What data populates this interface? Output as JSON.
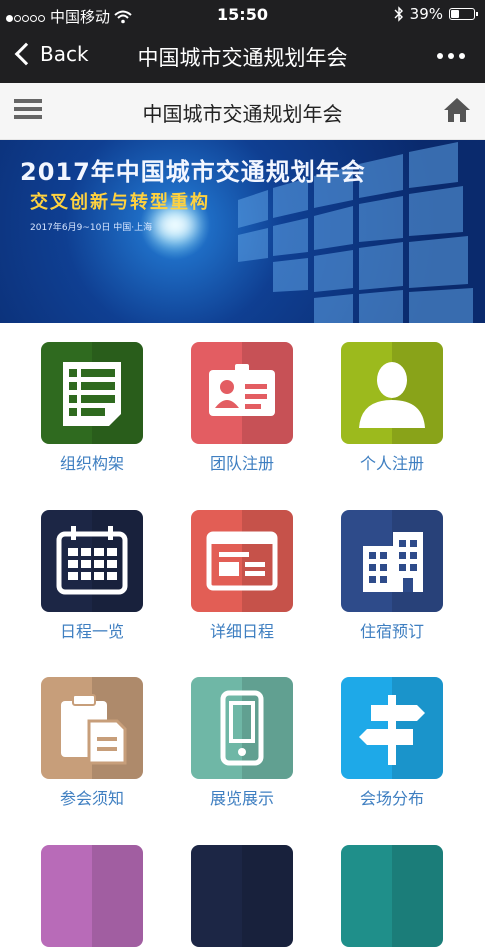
{
  "status_bar": {
    "carrier": "中国移动",
    "time": "15:50",
    "battery": "39%",
    "battery_level": 0.39
  },
  "nav": {
    "back_label": "Back",
    "title": "中国城市交通规划年会"
  },
  "page_header": {
    "title": "中国城市交通规划年会"
  },
  "banner": {
    "title": "2017年中国城市交通规划年会",
    "subtitle": "交叉创新与转型重构",
    "date_line": "2017年6月9~10日   中国·上海"
  },
  "grid": [
    {
      "label": "组织构架",
      "icon": "org-chart-icon",
      "color": "#2f6a1f"
    },
    {
      "label": "团队注册",
      "icon": "id-card-icon",
      "color": "#e35d62"
    },
    {
      "label": "个人注册",
      "icon": "user-icon",
      "color": "#9cba1d"
    },
    {
      "label": "日程一览",
      "icon": "calendar-icon",
      "color": "#1c2645"
    },
    {
      "label": "详细日程",
      "icon": "browser-window-icon",
      "color": "#e25e55"
    },
    {
      "label": "住宿预订",
      "icon": "building-icon",
      "color": "#2e4b8a"
    },
    {
      "label": "参会须知",
      "icon": "clipboard-icon",
      "color": "#c79e7a"
    },
    {
      "label": "展览展示",
      "icon": "mobile-device-icon",
      "color": "#6fb7a6"
    },
    {
      "label": "会场分布",
      "icon": "signpost-icon",
      "color": "#1ea9e8"
    }
  ]
}
